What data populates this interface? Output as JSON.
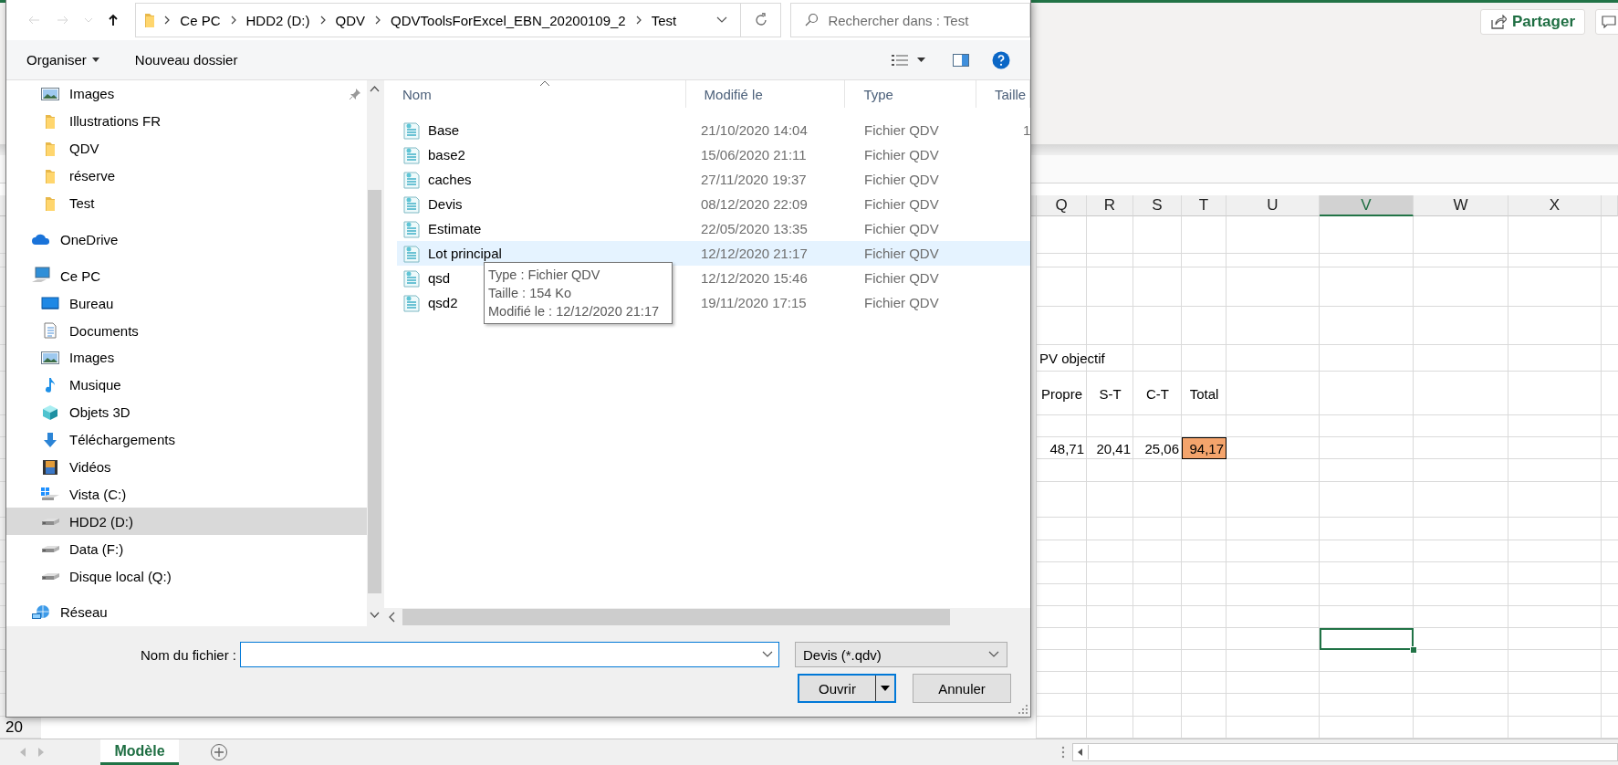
{
  "excel": {
    "share_button": "Partager",
    "columns": [
      {
        "label": "Q",
        "selected": false
      },
      {
        "label": "R",
        "selected": false
      },
      {
        "label": "S",
        "selected": false
      },
      {
        "label": "T",
        "selected": false
      },
      {
        "label": "U",
        "selected": false
      },
      {
        "label": "V",
        "selected": true
      },
      {
        "label": "W",
        "selected": false
      },
      {
        "label": "X",
        "selected": false
      }
    ],
    "content_rows": [
      {
        "cells": [
          {
            "text": "PV objectif",
            "kind": "text",
            "highlighted": false
          }
        ]
      },
      {
        "cells": [
          {
            "text": "Propre",
            "kind": "text",
            "highlighted": false
          },
          {
            "text": "S-T",
            "kind": "text",
            "highlighted": false
          },
          {
            "text": "C-T",
            "kind": "text",
            "highlighted": false
          },
          {
            "text": "Total",
            "kind": "text",
            "highlighted": false
          }
        ]
      },
      {
        "cells": [
          {
            "text": "48,71",
            "kind": "number",
            "highlighted": false
          },
          {
            "text": "20,41",
            "kind": "number",
            "highlighted": false
          },
          {
            "text": "25,06",
            "kind": "number",
            "highlighted": false
          },
          {
            "text": "94,17",
            "kind": "number",
            "highlighted": true
          }
        ]
      }
    ],
    "row_header": "20",
    "sheet_tabs": [
      {
        "label": "Modèle",
        "selected": true
      }
    ]
  },
  "dialog": {
    "nav_buttons": [
      {
        "kind": "back",
        "disabled": true
      },
      {
        "kind": "forward",
        "disabled": true
      },
      {
        "kind": "recent",
        "disabled": true
      },
      {
        "kind": "up",
        "disabled": false
      }
    ],
    "breadcrumb": [
      "Ce PC",
      "HDD2 (D:)",
      "QDV",
      "QDVToolsForExcel_EBN_20200109_2",
      "Test"
    ],
    "search": {
      "placeholder": "Rechercher dans : Test"
    },
    "toolbar": {
      "organize": "Organiser",
      "new_folder": "Nouveau dossier"
    },
    "nav_pane": {
      "quick_access": [
        {
          "label": "Images",
          "kind": "pictures",
          "pinned": true,
          "selected": false
        },
        {
          "label": "Illustrations FR",
          "kind": "folder",
          "pinned": false,
          "selected": false
        },
        {
          "label": "QDV",
          "kind": "folder",
          "pinned": false,
          "selected": false
        },
        {
          "label": "réserve",
          "kind": "folder",
          "pinned": false,
          "selected": false
        },
        {
          "label": "Test",
          "kind": "folder",
          "pinned": false,
          "selected": false
        }
      ],
      "tree": [
        {
          "label": "OneDrive",
          "kind": "cloud",
          "selected": false
        },
        {
          "label": "Ce PC",
          "kind": "pc",
          "selected": false,
          "children": [
            {
              "label": "Bureau",
              "kind": "desktop",
              "selected": false
            },
            {
              "label": "Documents",
              "kind": "documents",
              "selected": false
            },
            {
              "label": "Images",
              "kind": "pictures",
              "selected": false
            },
            {
              "label": "Musique",
              "kind": "music",
              "selected": false
            },
            {
              "label": "Objets 3D",
              "kind": "objects3d",
              "selected": false
            },
            {
              "label": "Téléchargements",
              "kind": "downloads",
              "selected": false
            },
            {
              "label": "Vidéos",
              "kind": "videos",
              "selected": false
            },
            {
              "label": "Vista (C:)",
              "kind": "drive_windows",
              "selected": false
            },
            {
              "label": "HDD2 (D:)",
              "kind": "drive",
              "selected": true
            },
            {
              "label": "Data (F:)",
              "kind": "drive",
              "selected": false
            },
            {
              "label": "Disque local (Q:)",
              "kind": "drive",
              "selected": false
            }
          ]
        },
        {
          "label": "Réseau",
          "kind": "network",
          "selected": false
        }
      ]
    },
    "file_list": {
      "columns": [
        "Nom",
        "Modifié le",
        "Type",
        "Taille"
      ],
      "rows": [
        {
          "name": "Base",
          "modified": "21/10/2020 14:04",
          "type": "Fichier QDV",
          "size": "1",
          "hovered": false
        },
        {
          "name": "base2",
          "modified": "15/06/2020 21:11",
          "type": "Fichier QDV",
          "hovered": false
        },
        {
          "name": "caches",
          "modified": "27/11/2020 19:37",
          "type": "Fichier QDV",
          "hovered": false
        },
        {
          "name": "Devis",
          "modified": "08/12/2020 22:09",
          "type": "Fichier QDV",
          "hovered": false
        },
        {
          "name": "Estimate",
          "modified": "22/05/2020 13:35",
          "type": "Fichier QDV",
          "hovered": false
        },
        {
          "name": "Lot principal",
          "modified": "12/12/2020 21:17",
          "type": "Fichier QDV",
          "hovered": true
        },
        {
          "name": "qsd",
          "modified": "12/12/2020 15:46",
          "type": "Fichier QDV",
          "hovered": false
        },
        {
          "name": "qsd2",
          "modified": "19/11/2020 17:15",
          "type": "Fichier QDV",
          "hovered": false
        }
      ]
    },
    "tooltip": [
      "Type : Fichier QDV",
      "Taille : 154 Ko",
      "Modifié le : 12/12/2020 21:17"
    ],
    "filename_label": "Nom du fichier :",
    "filter": "Devis (*.qdv)",
    "buttons": [
      {
        "label": "Ouvrir",
        "kind": "split",
        "default": true
      },
      {
        "label": "Annuler",
        "kind": "plain",
        "default": false
      }
    ]
  }
}
